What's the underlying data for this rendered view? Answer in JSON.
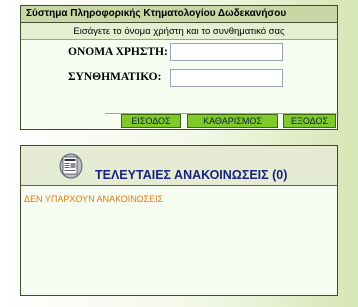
{
  "login": {
    "title": "Σύστημα Πληροφορικής Κτηματολογίου Δωδεκανήσου",
    "subtitle": "Εισάγετε το όνομα χρήστη και το συνθηματικό σας",
    "username_label": "ΟΝΟΜΑ ΧΡΗΣΤΗ:",
    "username_value": "",
    "password_label": "ΣΥΝΘΗΜΑΤΙΚΟ:",
    "password_value": "",
    "login_button": "ΕΙΣΟΔΟΣ",
    "clear_button": "ΚΑΘΑΡΙΣΜΟΣ",
    "exit_button": "ΕΞΟΔΟΣ"
  },
  "announcements": {
    "title": "ΤΕΛΕΥΤΑΙΕΣ ΑΝΑΚΟΙΝΩΣΕΙΣ (0)",
    "empty_text": "ΔΕΝ ΥΠΑΡΧΟΥΝ ΑΝΑΚΟΙΝΩΣΕΙΣ",
    "icon": "newspaper-icon"
  },
  "colors": {
    "button_green": "#7fc92a",
    "title_bar": "#c9d6a6",
    "announcement_title": "#1a237e",
    "empty_text": "#e07a10"
  }
}
